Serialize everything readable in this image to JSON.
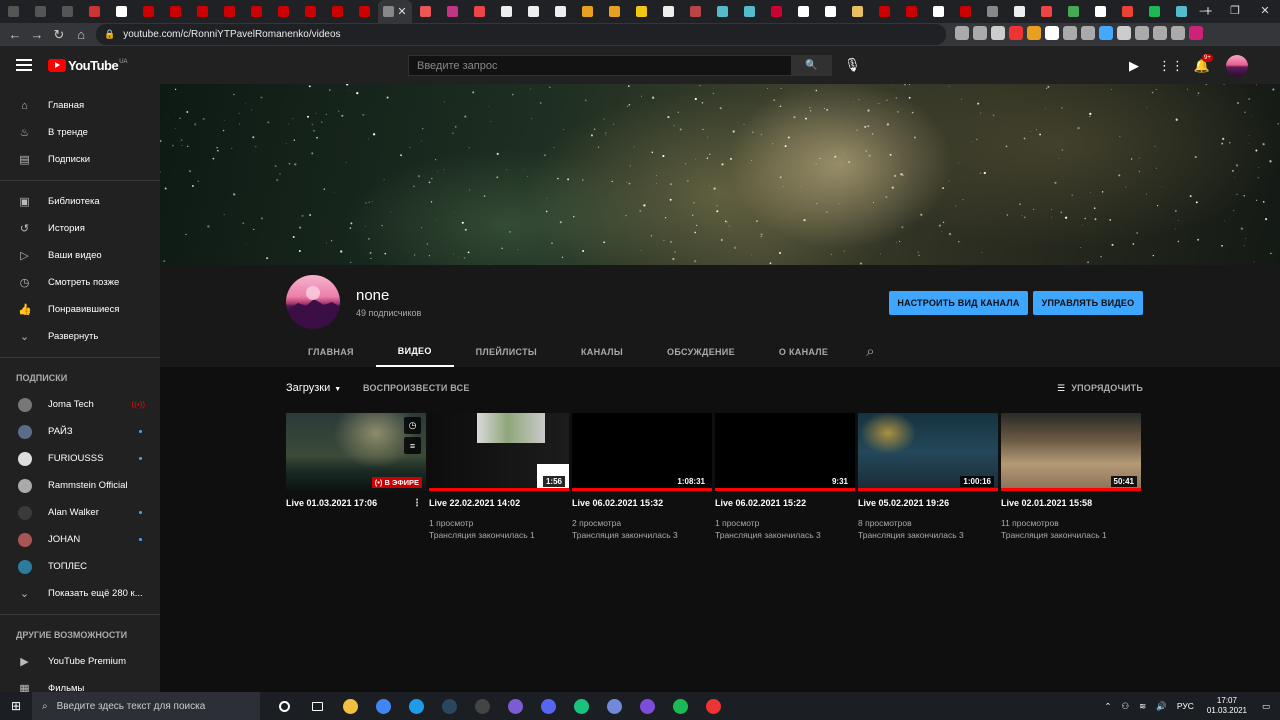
{
  "browser": {
    "tab_favicon_colors": [
      "#555",
      "#555",
      "#555",
      "#c33",
      "#fff",
      "#c00",
      "#c00",
      "#c00",
      "#c00",
      "#c00",
      "#c00",
      "#c00",
      "#c00",
      "#c00",
      "#888",
      "#e55",
      "#c13584",
      "#e44",
      "#eee",
      "#eee",
      "#eee",
      "#e8a020",
      "#e8a020",
      "#f2c811",
      "#eee",
      "#b44",
      "#5bc",
      "#5bc",
      "#c03",
      "#fff",
      "#fff",
      "#e8c060",
      "#c00",
      "#c00",
      "#fff",
      "#c00",
      "#888",
      "#eee",
      "#e44",
      "#4a5",
      "#fff",
      "#ea4335",
      "#1db954",
      "#5bc"
    ],
    "url": "youtube.com/c/RonniYTPavelRomanenko/videos",
    "extension_colors": [
      "#aaa",
      "#aaa",
      "#ccc",
      "#e33",
      "#e8a020",
      "#fff",
      "#aaa",
      "#aaa",
      "#4af",
      "#ccc",
      "#aaa",
      "#aaa",
      "#aaa",
      "#c27"
    ]
  },
  "header": {
    "logo_text": "YouTube",
    "region": "UA",
    "search_placeholder": "Введите запрос",
    "notif_count": "9+"
  },
  "sidebar": {
    "main": [
      {
        "label": "Главная",
        "icon": "home-icon"
      },
      {
        "label": "В тренде",
        "icon": "fire-icon"
      },
      {
        "label": "Подписки",
        "icon": "subscriptions-icon"
      }
    ],
    "library": [
      {
        "label": "Библиотека",
        "icon": "library-icon"
      },
      {
        "label": "История",
        "icon": "history-icon"
      },
      {
        "label": "Ваши видео",
        "icon": "your-videos-icon"
      },
      {
        "label": "Смотреть позже",
        "icon": "watch-later-icon"
      },
      {
        "label": "Понравившиеся",
        "icon": "like-icon"
      },
      {
        "label": "Развернуть",
        "icon": "chevron-down-icon"
      }
    ],
    "subs_heading": "ПОДПИСКИ",
    "subs": [
      {
        "label": "Joma Tech",
        "color": "#777",
        "mark": "live"
      },
      {
        "label": "РАЙЗ",
        "color": "#5a6c8a",
        "mark": "dot"
      },
      {
        "label": "FURIOUSSS",
        "color": "#ddd",
        "mark": "dot"
      },
      {
        "label": "Rammstein Official",
        "color": "#aaa",
        "mark": "none"
      },
      {
        "label": "Alan Walker",
        "color": "#3a3a3a",
        "mark": "dot"
      },
      {
        "label": "JOHAN",
        "color": "#a55",
        "mark": "dot"
      },
      {
        "label": "ТОПЛЕС",
        "color": "#2b7c9e",
        "mark": "none"
      }
    ],
    "show_more": "Показать ещё 280 к...",
    "more_heading": "ДРУГИЕ ВОЗМОЖНОСТИ",
    "more": [
      {
        "label": "YouTube Premium",
        "icon": "youtube-premium-icon"
      },
      {
        "label": "Фильмы",
        "icon": "movies-icon"
      }
    ]
  },
  "channel": {
    "name": "none",
    "subscribers": "49 подписчиков",
    "customize_button": "НАСТРОИТЬ ВИД КАНАЛА",
    "manage_button": "УПРАВЛЯТЬ ВИДЕО",
    "tabs": [
      "ГЛАВНАЯ",
      "ВИДЕО",
      "ПЛЕЙЛИСТЫ",
      "КАНАЛЫ",
      "ОБСУЖДЕНИЕ",
      "О КАНАЛЕ"
    ],
    "active_tab": 1
  },
  "videos_section": {
    "filter_label": "Загрузки",
    "play_all": "ВОСПРОИЗВЕСТИ ВСЕ",
    "sort_label": "УПОРЯДОЧИТЬ"
  },
  "videos": [
    {
      "title": "Live 01.03.2021 17:06",
      "badge": "(•) В ЭФИРЕ",
      "duration": "",
      "views": "",
      "status": "",
      "thumb": "night-sky"
    },
    {
      "title": "Live 22.02.2021 14:02",
      "badge": "",
      "duration": "1:56",
      "views": "1 просмотр",
      "status": "Трансляция закончилась 1",
      "thumb": "webcam"
    },
    {
      "title": "Live 06.02.2021 15:32",
      "badge": "",
      "duration": "1:08:31",
      "views": "2 просмотра",
      "status": "Трансляция закончилась 3",
      "thumb": "black"
    },
    {
      "title": "Live 06.02.2021 15:22",
      "badge": "",
      "duration": "9:31",
      "views": "1 просмотр",
      "status": "Трансляция закончилась 3",
      "thumb": "black"
    },
    {
      "title": "Live 05.02.2021 19:26",
      "badge": "",
      "duration": "1:00:16",
      "views": "8 просмотров",
      "status": "Трансляция закончилась 3",
      "thumb": "game-blue"
    },
    {
      "title": "Live 02.01.2021 15:58",
      "badge": "",
      "duration": "50:41",
      "views": "11 просмотров",
      "status": "Трансляция закончилась 1",
      "thumb": "game-sand"
    }
  ],
  "taskbar": {
    "search_placeholder": "Введите здесь текст для поиска",
    "app_colors": [
      "#f0c040",
      "#4285f4",
      "#1e9be9",
      "#2a475e",
      "#444",
      "#7b5bd6",
      "#5865f2",
      "#19c37d",
      "#7289da",
      "#7d4cdb",
      "#1db954",
      "#e33"
    ],
    "lang": "РУС",
    "time": "17:07",
    "date": "01.03.2021"
  }
}
